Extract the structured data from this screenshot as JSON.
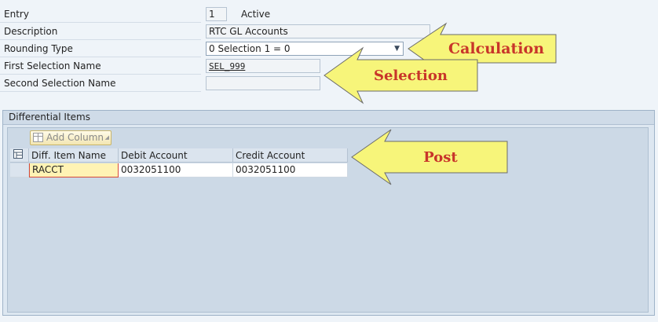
{
  "form": {
    "entry_label": "Entry",
    "entry_value": "1",
    "status": "Active",
    "description_label": "Description",
    "description_value": "RTC GL Accounts",
    "rounding_label": "Rounding Type",
    "rounding_value": "0 Selection 1 = 0",
    "first_sel_label": "First Selection Name",
    "first_sel_value": "SEL_999",
    "second_sel_label": "Second Selection Name",
    "second_sel_value": ""
  },
  "differential_items": {
    "title": "Differential Items",
    "add_column_label": "Add Column",
    "columns": [
      "Diff. Item Name",
      "Debit Account",
      "Credit Account"
    ],
    "rows": [
      [
        "RACCT",
        "0032051100",
        "0032051100"
      ]
    ]
  },
  "annotations": {
    "calculation": "Calculation",
    "selection": "Selection",
    "post": "Post"
  },
  "colors": {
    "arrow_fill": "#f7f57a",
    "arrow_text": "#c8352a"
  }
}
